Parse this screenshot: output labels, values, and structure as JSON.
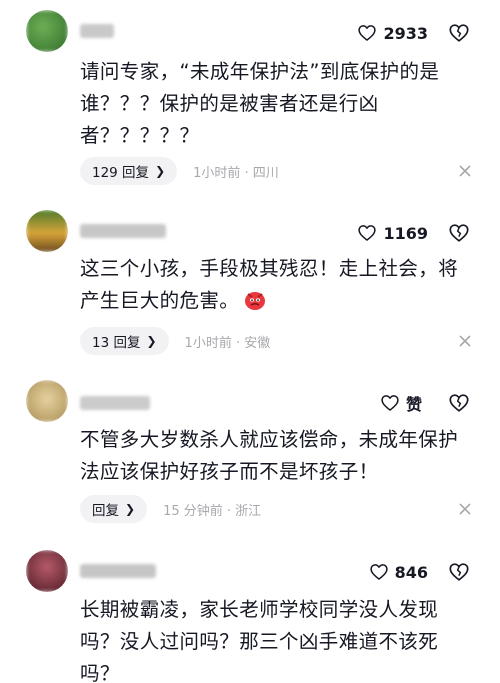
{
  "comments": [
    {
      "likes": "2933",
      "text_lines": [
        "请问专家，“未成年保护法”到底保护的是",
        "谁？？？保护的是被害者还是行凶",
        "者？？？？？"
      ],
      "reply_label": "129 回复",
      "time_location": "1小时前 · 四川",
      "avatar_color": "#4a8a3a",
      "name_color": "#bfbfbf"
    },
    {
      "likes": "1169",
      "text_lines": [
        "这三个小孩，手段极其残忍！走上社会，将",
        "产生巨大的危害。"
      ],
      "reply_label": "13 回复",
      "time_location": "1小时前 · 安徽",
      "avatar_color": "#9a8a2e",
      "name_color": "#c4c4c4"
    },
    {
      "likes": "赞",
      "text_lines": [
        "不管多大岁数杀人就应该偿命，未成年保护",
        "法应该保护好孩子而不是坏孩子！"
      ],
      "reply_label": "回复",
      "time_location": "15 分钟前 · 浙江",
      "avatar_color": "#c9b27a",
      "name_color": "#c8c8c8"
    },
    {
      "likes": "846",
      "text_lines": [
        "长期被霸凌，家长老师学校同学没人发现",
        "吗？没人过问吗？那三个凶手难道不该死",
        "吗？"
      ],
      "avatar_color": "#7a2e3a",
      "name_color": "#c0c0c0"
    }
  ],
  "colors": {
    "text": "#161823",
    "meta": "#a8a9ad",
    "reply_bg": "#f2f2f4"
  },
  "icons": {
    "like": "heart-outline-icon",
    "dislike": "dislike-heart-icon",
    "close": "close-icon",
    "chevron": "chevron-right-icon",
    "emoji": "angry-face-emoji"
  }
}
